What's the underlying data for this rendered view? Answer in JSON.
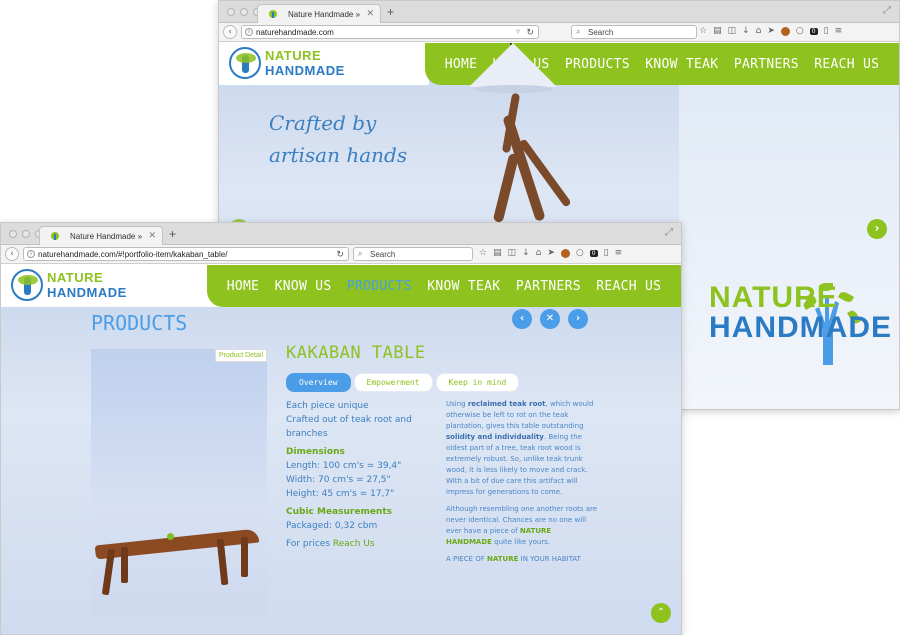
{
  "back_window": {
    "tab_title": "Nature Handmade »",
    "url": "naturehandmade.com",
    "search_placeholder": "Search",
    "logo": {
      "line1": "NATURE",
      "line2": "HANDMADE"
    },
    "nav": [
      "HOME",
      "KNOW US",
      "PRODUCTS",
      "KNOW TEAK",
      "PARTNERS",
      "REACH US"
    ],
    "hero_line1": "Crafted by",
    "hero_line2": "artisan hands",
    "next_icon": "chevron-right",
    "big_logo": {
      "line1": "NATURE",
      "line2": "HANDMADE"
    }
  },
  "front_window": {
    "tab_title": "Nature Handmade »",
    "url": "naturehandmade.com/#!portfolio-item/kakaban_table/",
    "search_placeholder": "Search",
    "logo": {
      "line1": "NATURE",
      "line2": "HANDMADE"
    },
    "nav": [
      "HOME",
      "KNOW US",
      "PRODUCTS",
      "KNOW TEAK",
      "PARTNERS",
      "REACH US"
    ],
    "active_nav": "PRODUCTS",
    "section_title": "PRODUCTS",
    "photo_badge": "Product Detail",
    "product_title": "KAKABAN TABLE",
    "tabs": [
      "Overview",
      "Empowerment",
      "Keep in mind"
    ],
    "left": {
      "l1": "Each piece unique",
      "l2": "Crafted out of teak root and branches",
      "dim_head": "Dimensions",
      "d1": "Length: 100 cm's = 39,4\"",
      "d2": "Width: 70 cm's = 27,5\"",
      "d3": "Height: 45 cm's = 17,7\"",
      "cubic_head": "Cubic Measurements",
      "packaged": "Packaged: 0,32 cbm",
      "prices": "For prices",
      "reach": "Reach Us"
    },
    "right": {
      "p1_a": "Using",
      "p1_b": "reclaimed teak root",
      "p1_c": ", which would otherwise be left to rot on the teak plantation, gives this table outstanding",
      "p1_d": "solidity and individuality",
      "p1_e": ". Being the oldest part of a tree, teak root wood is extremely robust. So, unlike teak trunk wood, it is less likely to move and crack. With a bit of due care this artifact will impress for generations to come.",
      "p2_a": "Although resembling one another roots are never identical. Chances are no one will ever have a piece of",
      "p2_b": "NATURE HANDMADE",
      "p2_c": "quite like yours.",
      "p3_a": "A PIECE OF",
      "p3_b": "NATURE",
      "p3_c": "IN YOUR HABITAT"
    }
  },
  "colors": {
    "green": "#8dc21f",
    "blue": "#4a9de6",
    "dark_blue": "#2b7bc4"
  }
}
